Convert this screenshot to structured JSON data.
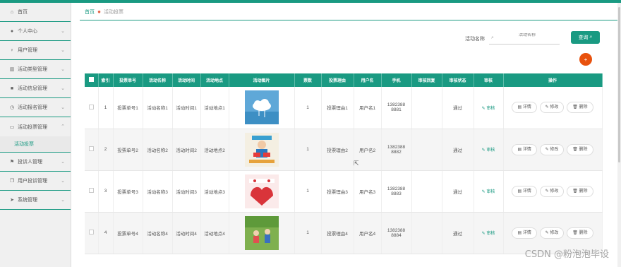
{
  "sidebar": {
    "items": [
      {
        "label": "首页",
        "icon": "home-icon",
        "glyph": "⌂"
      },
      {
        "label": "个人中心",
        "icon": "user-icon",
        "glyph": "●"
      },
      {
        "label": "用户管理",
        "icon": "user-manage-icon",
        "glyph": "♀"
      },
      {
        "label": "活动类型管理",
        "icon": "chart-icon",
        "glyph": "▥"
      },
      {
        "label": "活动信息管理",
        "icon": "briefcase-icon",
        "glyph": "■"
      },
      {
        "label": "活动报名管理",
        "icon": "clock-icon",
        "glyph": "◷"
      },
      {
        "label": "活动投票管理",
        "icon": "message-icon",
        "glyph": "▭",
        "expanded": true
      }
    ],
    "submenu": {
      "label": "活动投票"
    },
    "items_after": [
      {
        "label": "投诉人管理",
        "icon": "flag-icon",
        "glyph": "⚑"
      },
      {
        "label": "用户投诉管理",
        "icon": "copy-icon",
        "glyph": "❐"
      },
      {
        "label": "系统管理",
        "icon": "send-icon",
        "glyph": "➤"
      }
    ]
  },
  "breadcrumb": {
    "home": "首页",
    "current": "活动投票"
  },
  "search": {
    "label": "活动名称",
    "placeholder": "活动名称",
    "button": "查询"
  },
  "add_button": "+",
  "table": {
    "headers": [
      "",
      "索引",
      "投票单号",
      "活动名称",
      "活动时间",
      "活动地点",
      "活动图片",
      "票数",
      "投票理由",
      "用户名",
      "手机",
      "审核回复",
      "审核状态",
      "审核",
      "操作"
    ],
    "audit_label": "审核",
    "op_labels": {
      "detail": "详情",
      "edit": "修改",
      "delete": "删除"
    },
    "rows": [
      {
        "index": "1",
        "vote_no": "投票单号1",
        "name": "活动名称1",
        "time": "活动时间1",
        "place": "活动地点1",
        "votes": "1",
        "reason": "投票理由1",
        "user": "用户名1",
        "phone1": "1382388",
        "phone2": "8881",
        "reply": "",
        "status": "通过"
      },
      {
        "index": "2",
        "vote_no": "投票单号2",
        "name": "活动名称2",
        "time": "活动时间2",
        "place": "活动地点2",
        "votes": "1",
        "reason": "投票理由2",
        "user": "用户名2",
        "phone1": "1382388",
        "phone2": "8882",
        "reply": "",
        "status": "通过"
      },
      {
        "index": "3",
        "vote_no": "投票单号3",
        "name": "活动名称3",
        "time": "活动时间3",
        "place": "活动地点3",
        "votes": "1",
        "reason": "投票理由3",
        "user": "用户名3",
        "phone1": "1382388",
        "phone2": "8883",
        "reply": "",
        "status": "通过"
      },
      {
        "index": "4",
        "vote_no": "投票单号4",
        "name": "活动名称4",
        "time": "活动时间4",
        "place": "活动地点4",
        "votes": "1",
        "reason": "投票理由4",
        "user": "用户名4",
        "phone1": "1382388",
        "phone2": "8884",
        "reply": "",
        "status": "通过"
      }
    ]
  },
  "watermark": "CSDN @粉泡泡毕设",
  "colors": {
    "primary": "#1a9a82",
    "accent": "#e8510d"
  }
}
